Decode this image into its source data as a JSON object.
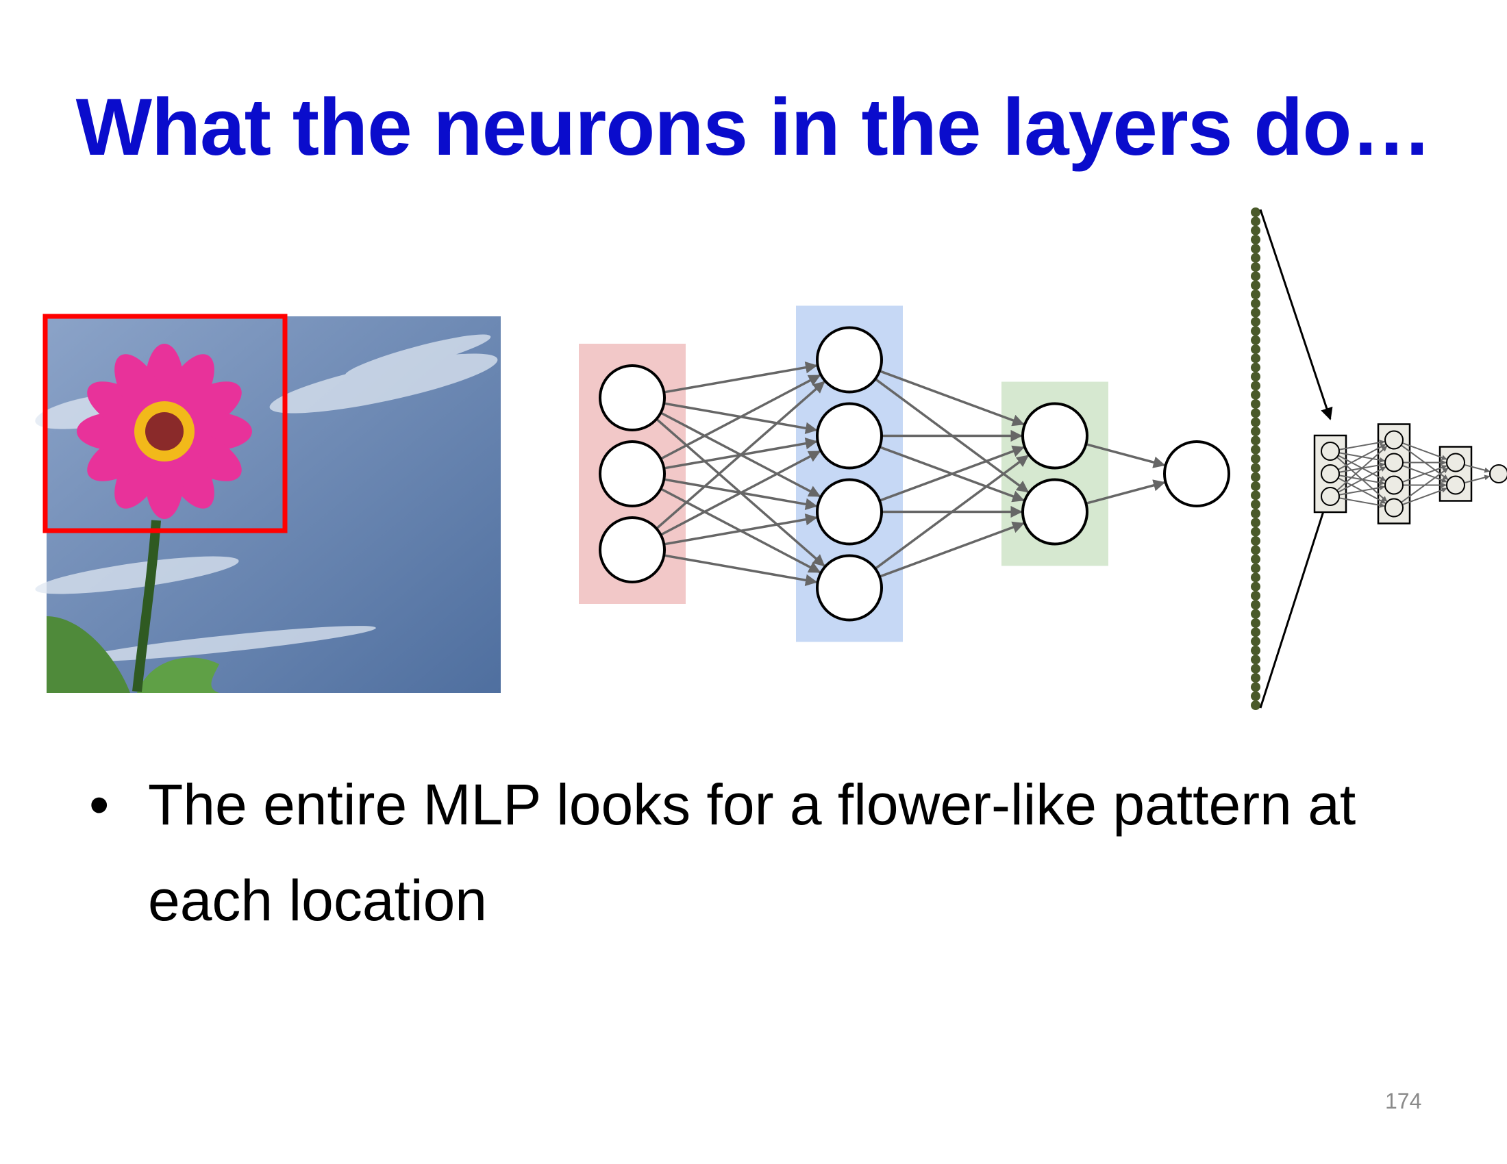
{
  "slide": {
    "title": "What the neurons in the layers do…",
    "bullet_marker": "•",
    "bullet_text": "The entire MLP looks for a flower-like pattern at each location",
    "page_number": "174"
  },
  "image": {
    "subject": "pink-flower-against-blue-sky",
    "highlight_color": "#ff0000",
    "sky_color": "#5b7aa8",
    "petal_color": "#e8329a"
  },
  "network": {
    "layers": [
      {
        "neurons": 3,
        "band_color": "#f2c8c8"
      },
      {
        "neurons": 4,
        "band_color": "#c6d8f5"
      },
      {
        "neurons": 2,
        "band_color": "#d6e8d0"
      },
      {
        "neurons": 1,
        "band_color": ""
      }
    ],
    "edge_color": "#666666",
    "input_strip_color": "#4a5a2a",
    "mini_network_layers": [
      3,
      4,
      2,
      1
    ]
  }
}
